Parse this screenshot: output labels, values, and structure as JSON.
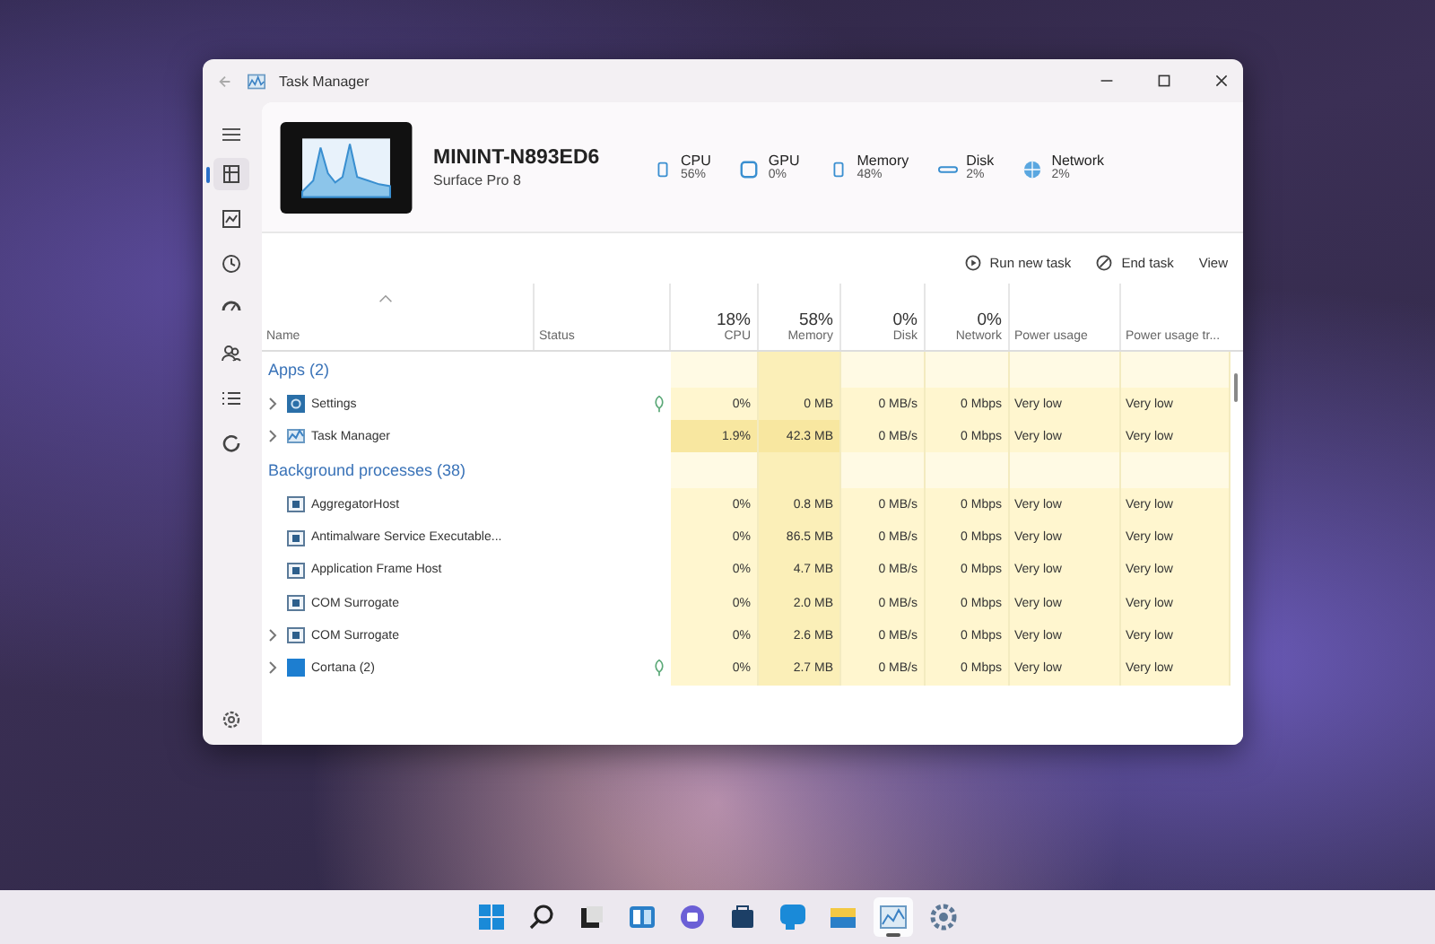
{
  "window": {
    "title": "Task Manager"
  },
  "sidebar": {
    "items": [
      {
        "kind": "processes",
        "selected": true
      },
      {
        "kind": "performance",
        "selected": false
      },
      {
        "kind": "history",
        "selected": false
      },
      {
        "kind": "startup",
        "selected": false
      },
      {
        "kind": "users",
        "selected": false
      },
      {
        "kind": "details",
        "selected": false
      },
      {
        "kind": "services",
        "selected": false
      }
    ]
  },
  "device": {
    "name": "MININT-N893ED6",
    "model": "Surface Pro 8"
  },
  "metrics": [
    {
      "kind": "cpu",
      "label": "CPU",
      "value": "56%"
    },
    {
      "kind": "gpu",
      "label": "GPU",
      "value": "0%"
    },
    {
      "kind": "memory",
      "label": "Memory",
      "value": "48%"
    },
    {
      "kind": "disk",
      "label": "Disk",
      "value": "2%"
    },
    {
      "kind": "network",
      "label": "Network",
      "value": "2%"
    }
  ],
  "toolbar": {
    "run_new_task": "Run new task",
    "end_task": "End task",
    "view": "View"
  },
  "table": {
    "columns": [
      {
        "label": "Name"
      },
      {
        "label": "Status"
      },
      {
        "label": "CPU",
        "total": "18%"
      },
      {
        "label": "Memory",
        "total": "58%"
      },
      {
        "label": "Disk",
        "total": "0%"
      },
      {
        "label": "Network",
        "total": "0%"
      },
      {
        "label": "Power usage"
      },
      {
        "label": "Power usage tr..."
      }
    ],
    "groups": [
      {
        "title": "Apps (2)",
        "rows": [
          {
            "name": "Settings",
            "kind": "settings",
            "expandable": true,
            "efficiency": true,
            "cells": [
              "0%",
              "0 MB",
              "0 MB/s",
              "0 Mbps",
              "Very low",
              "Very low"
            ]
          },
          {
            "name": "Task Manager",
            "kind": "taskmgr",
            "expandable": true,
            "efficiency": false,
            "cells": [
              "1.9%",
              "42.3 MB",
              "0 MB/s",
              "0 Mbps",
              "Very low",
              "Very low"
            ]
          }
        ]
      },
      {
        "title": "Background processes (38)",
        "rows": [
          {
            "name": "AggregatorHost",
            "kind": "process",
            "expandable": false,
            "efficiency": false,
            "cells": [
              "0%",
              "0.8 MB",
              "0 MB/s",
              "0 Mbps",
              "Very low",
              "Very low"
            ]
          },
          {
            "name": "Antimalware Service Executable...",
            "kind": "process",
            "expandable": false,
            "efficiency": false,
            "cells": [
              "0%",
              "86.5 MB",
              "0 MB/s",
              "0 Mbps",
              "Very low",
              "Very low"
            ]
          },
          {
            "name": "Application Frame Host",
            "kind": "process",
            "expandable": false,
            "efficiency": false,
            "cells": [
              "0%",
              "4.7 MB",
              "0 MB/s",
              "0 Mbps",
              "Very low",
              "Very low"
            ]
          },
          {
            "name": "COM Surrogate",
            "kind": "process",
            "expandable": false,
            "efficiency": false,
            "cells": [
              "0%",
              "2.0 MB",
              "0 MB/s",
              "0 Mbps",
              "Very low",
              "Very low"
            ]
          },
          {
            "name": "COM Surrogate",
            "kind": "process",
            "expandable": true,
            "efficiency": false,
            "cells": [
              "0%",
              "2.6 MB",
              "0 MB/s",
              "0 Mbps",
              "Very low",
              "Very low"
            ]
          },
          {
            "name": "Cortana (2)",
            "kind": "cortana",
            "expandable": true,
            "efficiency": true,
            "cells": [
              "0%",
              "2.7 MB",
              "0 MB/s",
              "0 Mbps",
              "Very low",
              "Very low"
            ]
          }
        ]
      }
    ]
  },
  "taskbar": {
    "items": [
      {
        "kind": "start",
        "active": false
      },
      {
        "kind": "search",
        "active": false
      },
      {
        "kind": "taskview",
        "active": false
      },
      {
        "kind": "widgets",
        "active": false
      },
      {
        "kind": "chat",
        "active": false
      },
      {
        "kind": "store",
        "active": false
      },
      {
        "kind": "edge",
        "active": false
      },
      {
        "kind": "explorer",
        "active": false
      },
      {
        "kind": "taskmgr",
        "active": true
      },
      {
        "kind": "settings",
        "active": false
      }
    ]
  }
}
